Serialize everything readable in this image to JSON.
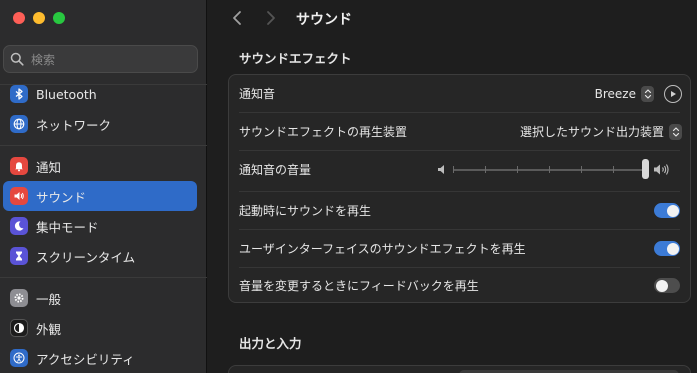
{
  "window": {
    "controls": [
      "close",
      "minimize",
      "zoom"
    ]
  },
  "search": {
    "placeholder": "検索"
  },
  "sidebar": {
    "items": [
      {
        "label": "Bluetooth",
        "icon": "bluetooth-icon",
        "color": "#2f6bc8",
        "active": false
      },
      {
        "label": "ネットワーク",
        "icon": "globe-icon",
        "color": "#2f6bc8",
        "active": false
      },
      {
        "label": "通知",
        "icon": "bell-icon",
        "color": "#e5483f",
        "active": false
      },
      {
        "label": "サウンド",
        "icon": "speaker-icon",
        "color": "#e5483f",
        "active": true
      },
      {
        "label": "集中モード",
        "icon": "moon-icon",
        "color": "#5a53d6",
        "active": false
      },
      {
        "label": "スクリーンタイム",
        "icon": "hourglass-icon",
        "color": "#5a53d6",
        "active": false
      },
      {
        "label": "一般",
        "icon": "gear-icon",
        "color": "#8e8e93",
        "active": false
      },
      {
        "label": "外観",
        "icon": "appearance-icon",
        "color": "#1c1c1c",
        "active": false
      },
      {
        "label": "アクセシビリティ",
        "icon": "accessibility-icon",
        "color": "#2f6bc8",
        "active": false
      }
    ]
  },
  "header": {
    "title": "サウンド"
  },
  "sound_effects": {
    "section_title": "サウンドエフェクト",
    "alert_sound_label": "通知音",
    "alert_sound_value": "Breeze",
    "play_output_label": "サウンドエフェクトの再生装置",
    "play_output_value": "選択したサウンド出力装置",
    "alert_volume_label": "通知音の音量",
    "alert_volume_level": 1.0,
    "startup_label": "起動時にサウンドを再生",
    "startup_on": true,
    "ui_effects_label": "ユーザインターフェイスのサウンドエフェクトを再生",
    "ui_effects_on": true,
    "volume_feedback_label": "音量を変更するときにフィードバックを再生",
    "volume_feedback_on": false
  },
  "output_input": {
    "section_title": "出力と入力"
  },
  "colors": {
    "accent": "#3c7bd6",
    "selected_row": "#2f6bc8"
  }
}
